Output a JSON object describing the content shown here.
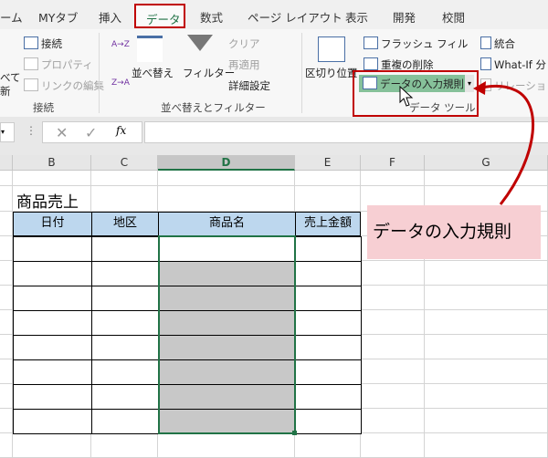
{
  "tabs": [
    "ーム",
    "MYタブ",
    "挿入",
    "データ",
    "数式",
    "ページ レイアウト",
    "表示",
    "開発",
    "校閲"
  ],
  "ribbon": {
    "refresh_label_1": "べて",
    "refresh_label_2": "新",
    "connections": "接続",
    "properties": "プロパティ",
    "edit_links": "リンクの編集",
    "group_connections": "接続",
    "sort_asc": "A→Z",
    "sort_desc": "Z→A",
    "sort": "並べ替え",
    "filter": "フィルター",
    "clear": "クリア",
    "reapply": "再適用",
    "advanced": "詳細設定",
    "group_sort": "並べ替えとフィルター",
    "text_to_columns": "区切り位置",
    "flash_fill": "フラッシュ フィル",
    "remove_duplicates": "重複の削除",
    "data_validation": "データの入力規則",
    "group_data_tools": "データ ツール",
    "consolidate": "統合",
    "what_if": "What-If 分",
    "relationships": "リレーションシ"
  },
  "formula_bar": {
    "cancel": "✕",
    "enter": "✓",
    "fx": "fx",
    "value": ""
  },
  "columns": [
    "B",
    "C",
    "D",
    "E",
    "F",
    "G"
  ],
  "sheet": {
    "title": "商品売上",
    "headers": [
      "日付",
      "地区",
      "商品名",
      "売上金額"
    ]
  },
  "callout": "データの入力規則",
  "colors": {
    "accent": "#217346",
    "highlight": "#c00000",
    "callout_bg": "#f7cfd3",
    "header_fill": "#bdd7ee"
  }
}
